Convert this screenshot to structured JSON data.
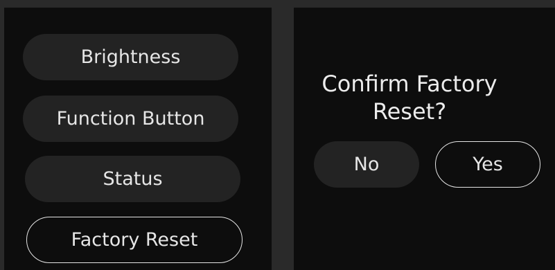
{
  "menu": {
    "items": [
      {
        "label": "Brightness",
        "selected": false
      },
      {
        "label": "Function Button",
        "selected": false
      },
      {
        "label": "Status",
        "selected": false
      },
      {
        "label": "Factory Reset",
        "selected": true
      }
    ]
  },
  "dialog": {
    "title_line1": "Confirm Factory",
    "title_line2": "Reset?",
    "no_label": "No",
    "yes_label": "Yes",
    "focused": "yes"
  },
  "colors": {
    "background": "#2a2a2a",
    "screen": "#0d0d0d",
    "pill": "#232323",
    "text": "#e6e6e6"
  }
}
